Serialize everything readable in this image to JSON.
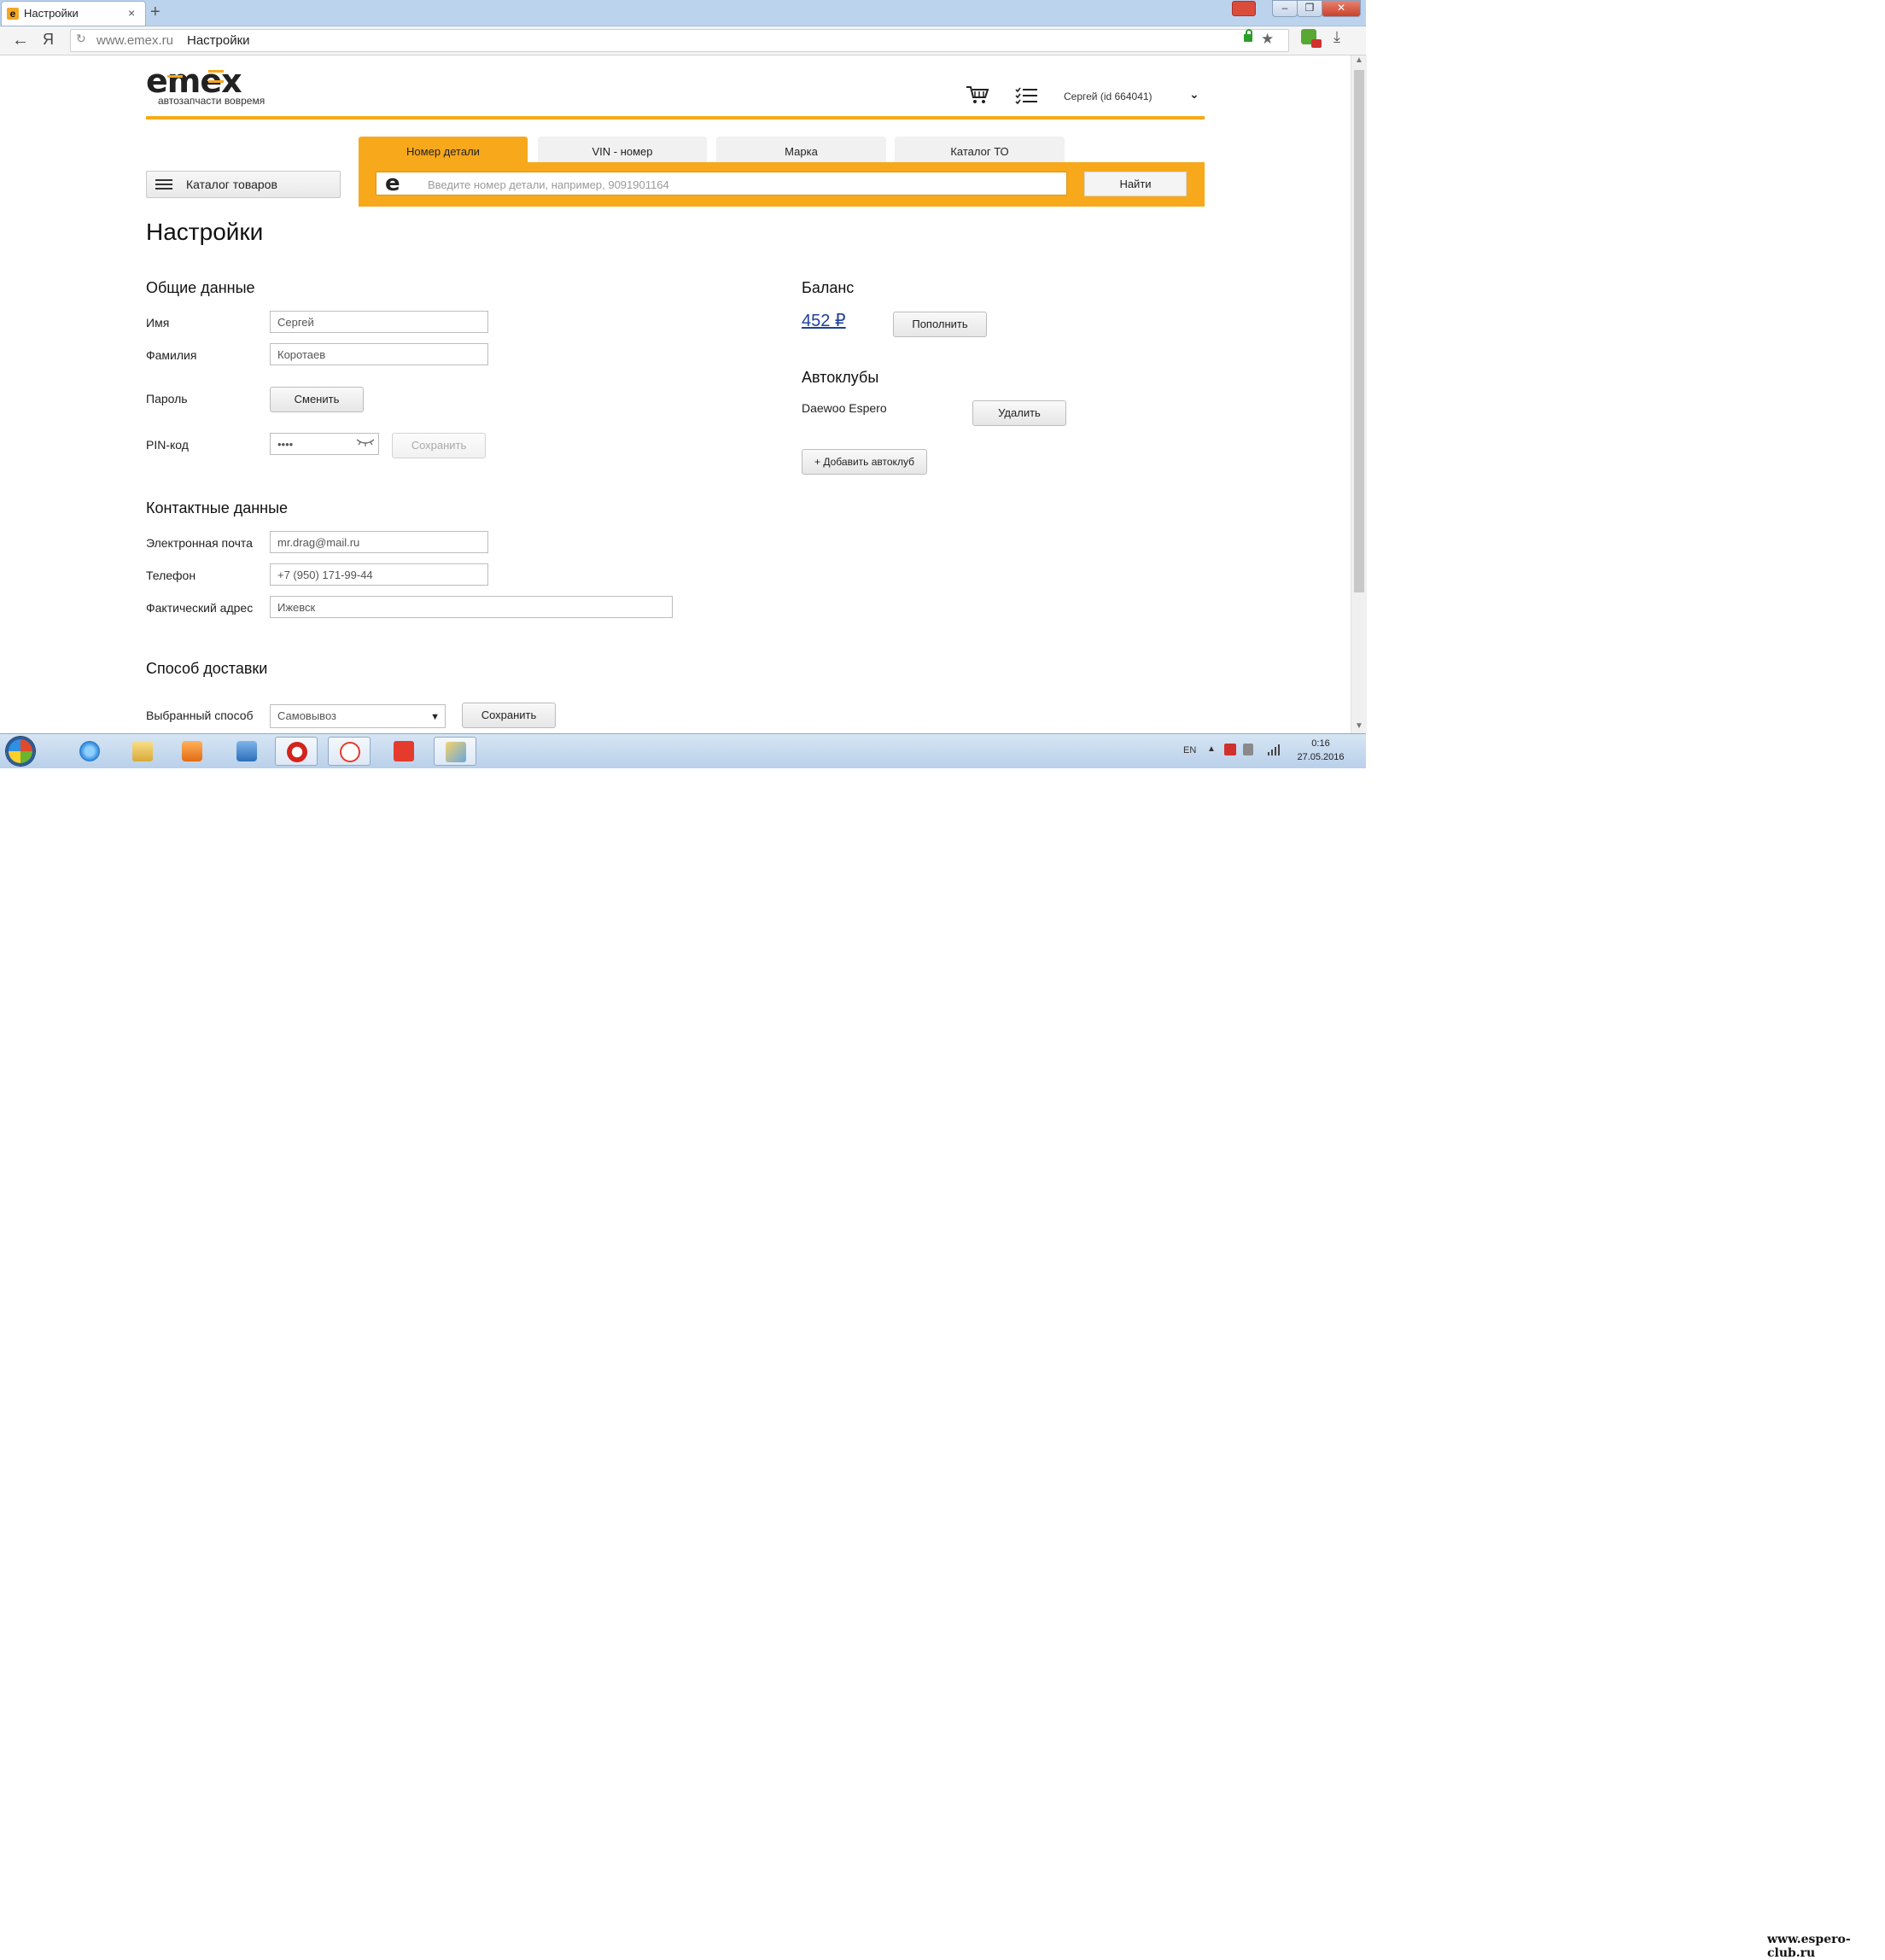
{
  "browser": {
    "tab_title": "Настройки",
    "tab_close": "×",
    "new_tab": "+",
    "window_buttons": {
      "minimize": "–",
      "restore": "❐",
      "close": "✕"
    },
    "back": "←",
    "ya": "Я",
    "reload": "↻",
    "url_host": "www.emex.ru",
    "url_title": "Настройки",
    "star": "★",
    "download": "⤓"
  },
  "header": {
    "logo": "emex",
    "tagline": "автозапчасти вовремя",
    "user": "Сергей  (id 664041)",
    "user_chevron": "⌄"
  },
  "search": {
    "catalog_button": "Каталог товаров",
    "tabs": [
      "Номер детали",
      "VIN - номер",
      "Марка",
      "Каталог ТО"
    ],
    "active_tab": "Номер детали",
    "input_logo": "e",
    "placeholder": "Введите номер детали, например, 9091901164",
    "submit": "Найти",
    "accent_color": "#f7a81b"
  },
  "page_title": "Настройки",
  "general": {
    "heading": "Общие данные",
    "name_label": "Имя",
    "name_value": "Сергей",
    "surname_label": "Фамилия",
    "surname_value": "Коротаев",
    "password_label": "Пароль",
    "password_button": "Сменить",
    "pin_label": "PIN-код",
    "pin_value": "••••",
    "pin_save": "Сохранить"
  },
  "contacts": {
    "heading": "Контактные данные",
    "email_label": "Электронная почта",
    "email_value": "mr.drag@mail.ru",
    "phone_label": "Телефон",
    "phone_value": "+7 (950) 171-99-44",
    "address_label": "Фактический адрес",
    "address_value": "Ижевск"
  },
  "delivery": {
    "heading": "Способ доставки",
    "label": "Выбранный способ",
    "selected": "Самовывоз",
    "arrow": "▼",
    "save": "Сохранить"
  },
  "balance": {
    "heading": "Баланс",
    "amount": "452 ₽",
    "topup": "Пополнить"
  },
  "autoclubs": {
    "heading": "Автоклубы",
    "items": [
      {
        "name": "Daewoo Espero",
        "remove": "Удалить"
      }
    ],
    "add": "+ Добавить автоклуб"
  },
  "taskbar": {
    "lang": "EN",
    "tray_arrow": "▲",
    "time": "0:16",
    "date": "27.05.2016"
  },
  "watermark": "www.espero-club.ru"
}
